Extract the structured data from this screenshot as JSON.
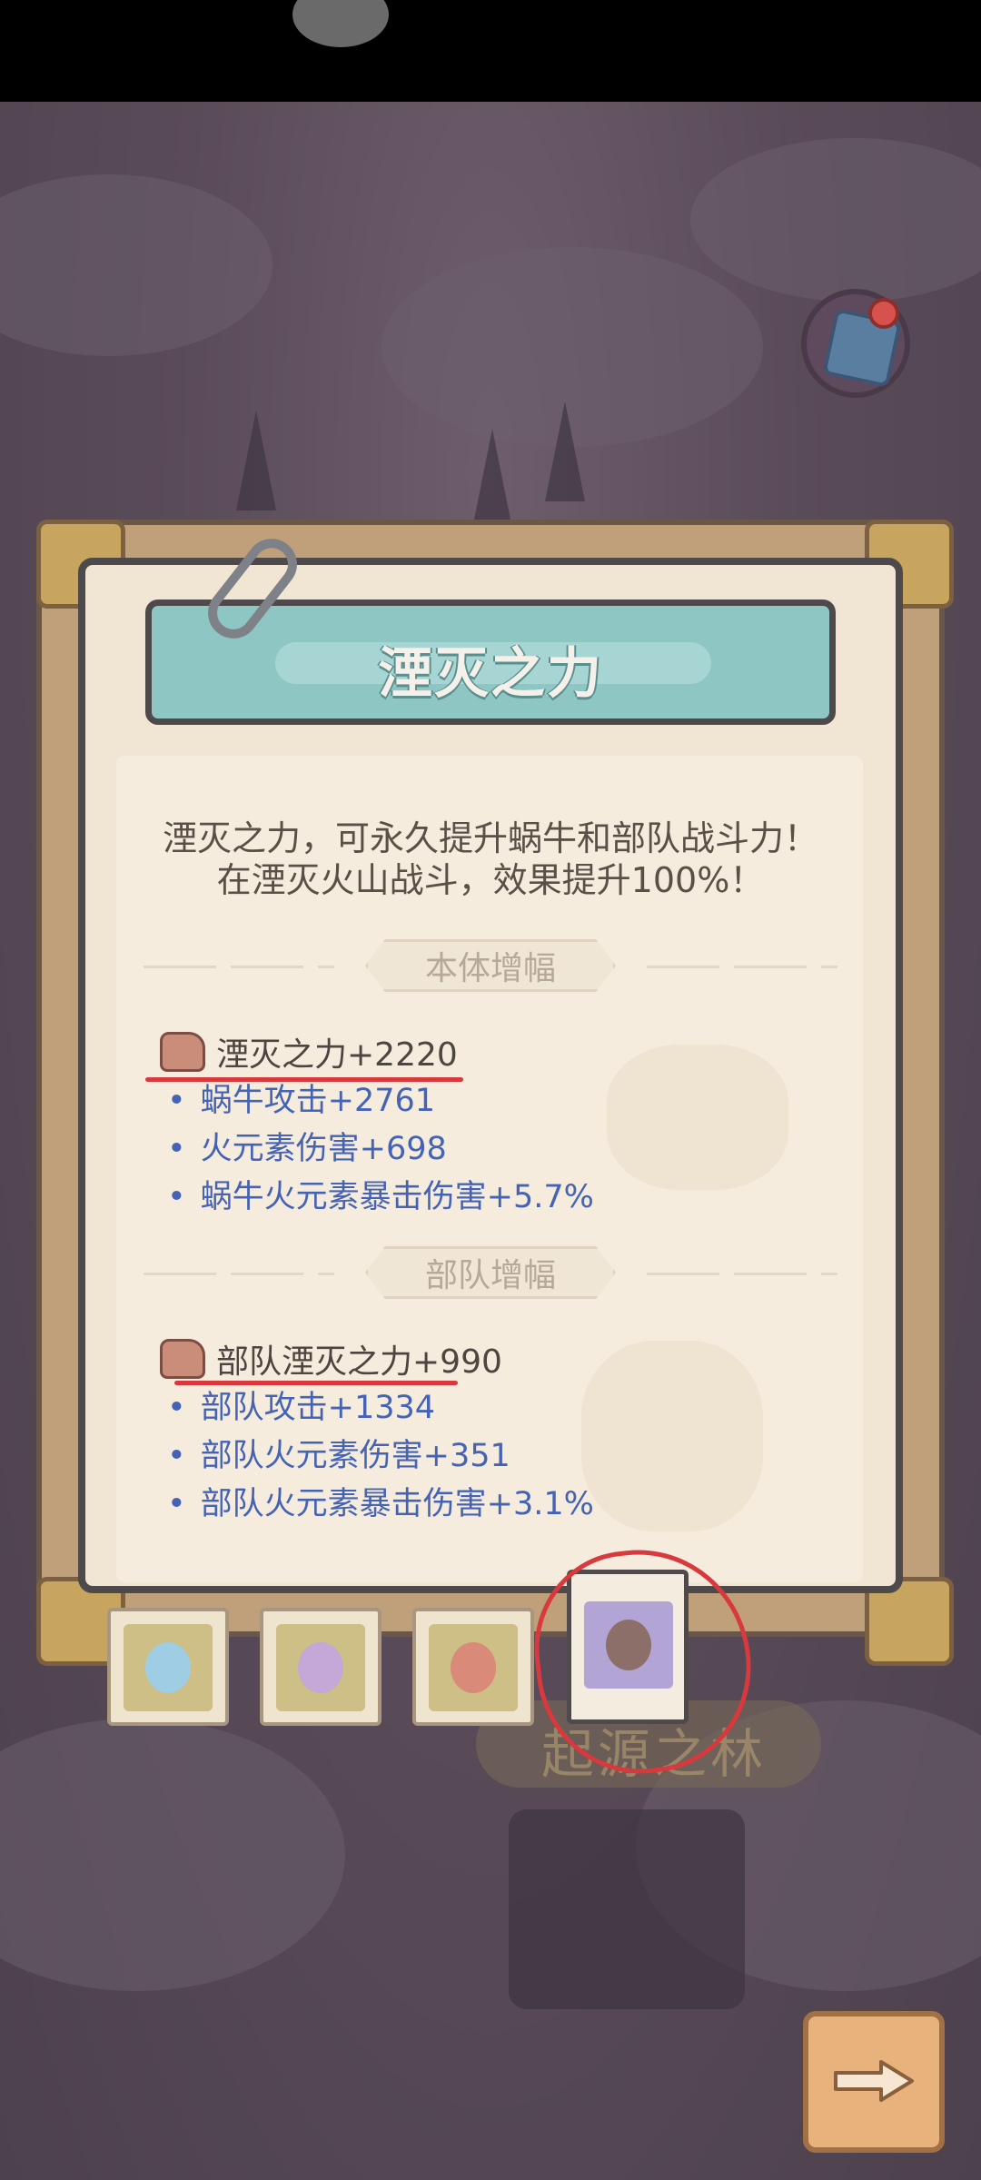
{
  "status_bar": {
    "indicator": ""
  },
  "panel": {
    "title": "湮灭之力",
    "description_line1": "湮灭之力，可永久提升蜗牛和部队战斗力！",
    "description_line2": "在湮灭火山战斗，效果提升100%！"
  },
  "self_section": {
    "label": "本体增幅",
    "headline": "湮灭之力+2220",
    "headline_icon": "rock-icon",
    "bullets": [
      "蜗牛攻击+2761",
      "火元素伤害+698",
      "蜗牛火元素暴击伤害+5.7%"
    ]
  },
  "troop_section": {
    "label": "部队增幅",
    "headline": "部队湮灭之力+990",
    "headline_icon": "troop-rock-icon",
    "bullets": [
      "部队攻击+1334",
      "部队火元素伤害+351",
      "部队火元素暴击伤害+3.1%"
    ]
  },
  "tabs": [
    {
      "icon": "blue-flower-icon",
      "active": false
    },
    {
      "icon": "purple-flower-icon",
      "active": false
    },
    {
      "icon": "red-crystal-icon",
      "active": false
    },
    {
      "icon": "purple-rock-icon",
      "active": true
    }
  ],
  "location": {
    "name": "起源之林"
  },
  "colors": {
    "accent_teal": "#8ec6c4",
    "bullet_blue": "#4563b5",
    "annotation_red": "#d8393c"
  }
}
